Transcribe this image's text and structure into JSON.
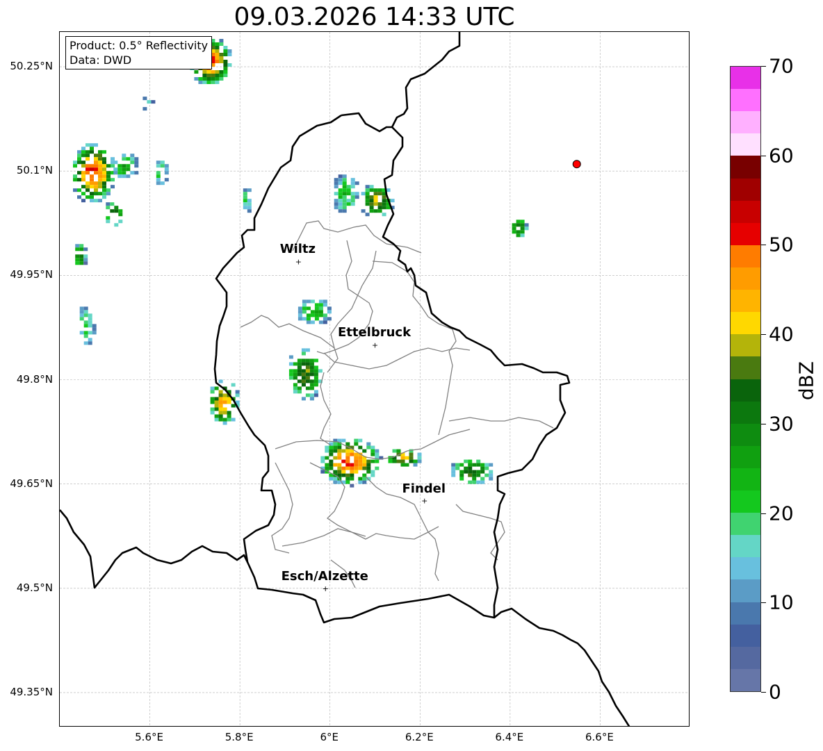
{
  "title": "09.03.2026 14:33 UTC",
  "info_box": {
    "product": "Product: 0.5° Reflectivity",
    "data": "Data: DWD"
  },
  "map": {
    "lon_range": [
      5.4,
      6.8
    ],
    "lat_range": [
      49.3,
      50.3
    ],
    "x_ticks": [
      "5.6°E",
      "5.8°E",
      "6°E",
      "6.2°E",
      "6.4°E",
      "6.6°E"
    ],
    "y_ticks": [
      "50.25°N",
      "50.1°N",
      "49.95°N",
      "49.8°N",
      "49.65°N",
      "49.5°N",
      "49.35°N"
    ],
    "grid": true,
    "border_color": "#000000",
    "canton_border_color": "#808080",
    "cities": [
      {
        "name": "Wiltz",
        "lon": 5.93,
        "lat": 49.97
      },
      {
        "name": "Ettelbruck",
        "lon": 6.1,
        "lat": 49.85
      },
      {
        "name": "Findel",
        "lon": 6.21,
        "lat": 49.626
      },
      {
        "name": "Esch/Alzette",
        "lon": 5.99,
        "lat": 49.5
      }
    ],
    "radar_site": {
      "lon": 6.548,
      "lat": 50.11,
      "color": "#ff0000"
    }
  },
  "colorbar": {
    "label": "dBZ",
    "min": 0,
    "max": 70,
    "tick_labels": [
      "0",
      "10",
      "20",
      "30",
      "40",
      "50",
      "60",
      "70"
    ],
    "tick_values": [
      0,
      10,
      20,
      30,
      40,
      50,
      60,
      70
    ],
    "colors": [
      "#6676a8",
      "#5569a0",
      "#44609f",
      "#4a78ad",
      "#5b9cc6",
      "#68c0de",
      "#64d6c6",
      "#40d370",
      "#14c81e",
      "#12b414",
      "#10a010",
      "#0e8c10",
      "#0c780e",
      "#0a640c",
      "#4a7a10",
      "#b4b40a",
      "#ffd800",
      "#ffb400",
      "#ff9c00",
      "#ff7c00",
      "#e60000",
      "#c80000",
      "#a00000",
      "#780000",
      "#ffe0ff",
      "#ffb0ff",
      "#ff70ff",
      "#e830e8"
    ]
  },
  "echo_cells": [
    {
      "lon": 5.73,
      "lat": 50.26,
      "rx": 0.05,
      "ry": 0.035,
      "peak": 44
    },
    {
      "lon": 5.47,
      "lat": 50.1,
      "rx": 0.05,
      "ry": 0.045,
      "peak": 44
    },
    {
      "lon": 5.515,
      "lat": 50.04,
      "rx": 0.022,
      "ry": 0.02,
      "peak": 30
    },
    {
      "lon": 5.44,
      "lat": 49.98,
      "rx": 0.015,
      "ry": 0.02,
      "peak": 25
    },
    {
      "lon": 5.455,
      "lat": 49.88,
      "rx": 0.02,
      "ry": 0.03,
      "peak": 14
    },
    {
      "lon": 5.62,
      "lat": 50.1,
      "rx": 0.015,
      "ry": 0.02,
      "peak": 16
    },
    {
      "lon": 5.54,
      "lat": 50.11,
      "rx": 0.03,
      "ry": 0.02,
      "peak": 20
    },
    {
      "lon": 6.1,
      "lat": 50.06,
      "rx": 0.04,
      "ry": 0.025,
      "peak": 32
    },
    {
      "lon": 6.03,
      "lat": 50.07,
      "rx": 0.03,
      "ry": 0.03,
      "peak": 16
    },
    {
      "lon": 5.96,
      "lat": 49.9,
      "rx": 0.04,
      "ry": 0.02,
      "peak": 18
    },
    {
      "lon": 5.94,
      "lat": 49.81,
      "rx": 0.04,
      "ry": 0.04,
      "peak": 30
    },
    {
      "lon": 5.76,
      "lat": 49.77,
      "rx": 0.035,
      "ry": 0.035,
      "peak": 38
    },
    {
      "lon": 6.04,
      "lat": 49.685,
      "rx": 0.07,
      "ry": 0.035,
      "peak": 44
    },
    {
      "lon": 6.16,
      "lat": 49.69,
      "rx": 0.04,
      "ry": 0.015,
      "peak": 36
    },
    {
      "lon": 6.31,
      "lat": 49.67,
      "rx": 0.05,
      "ry": 0.02,
      "peak": 28
    },
    {
      "lon": 6.415,
      "lat": 50.02,
      "rx": 0.02,
      "ry": 0.015,
      "peak": 28
    },
    {
      "lon": 5.59,
      "lat": 50.2,
      "rx": 0.015,
      "ry": 0.012,
      "peak": 8
    },
    {
      "lon": 5.81,
      "lat": 50.06,
      "rx": 0.012,
      "ry": 0.02,
      "peak": 14
    }
  ]
}
